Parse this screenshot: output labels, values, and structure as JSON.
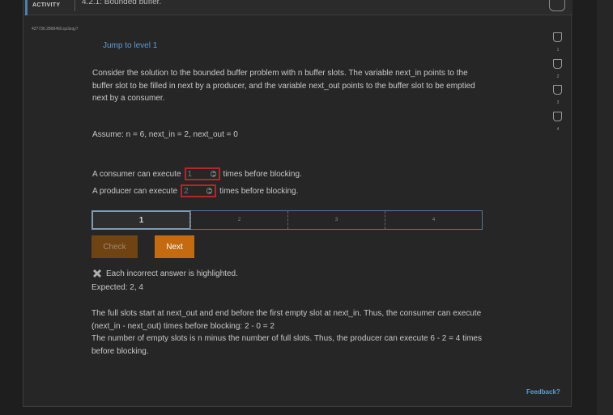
{
  "header": {
    "type_label": "ACTIVITY",
    "title": "4.2.1: Bounded buffer."
  },
  "session_id": "427736.2868460.qx3zqy7",
  "jump_link": "Jump to level 1",
  "progress_levels": [
    "1",
    "2",
    "3",
    "4"
  ],
  "prompt": "Consider the solution to the bounded buffer problem with n buffer slots. The variable next_in points to the buffer slot to be filled in next by a producer, and the variable next_out points to the buffer slot to be emptied next by a consumer.",
  "assume": "Assume: n = 6, next_in = 2, next_out = 0",
  "questions": [
    {
      "before": "A consumer can execute",
      "value": "1",
      "after": "times before blocking."
    },
    {
      "before": "A producer can execute",
      "value": "2",
      "after": "times before blocking."
    }
  ],
  "level_bar": [
    "1",
    "2",
    "3",
    "4"
  ],
  "buttons": {
    "check": "Check",
    "next": "Next"
  },
  "result": {
    "icon": "x-mark-icon",
    "message": "Each incorrect answer is highlighted.",
    "expected": "Expected: 2, 4"
  },
  "explanation": [
    "The full slots start at next_out and end before the first empty slot at next_in. Thus, the consumer can execute (next_in - next_out) times before blocking: 2 - 0 = 2",
    "The number of empty slots is n minus the number of full slots. Thus, the producer can execute 6 - 2 = 4 times before blocking."
  ],
  "feedback_link": "Feedback?",
  "colors": {
    "error_border": "#b3262a",
    "next_button": "#c46a10",
    "check_button_disabled": "#6f4312",
    "link": "#5b9bd5"
  }
}
